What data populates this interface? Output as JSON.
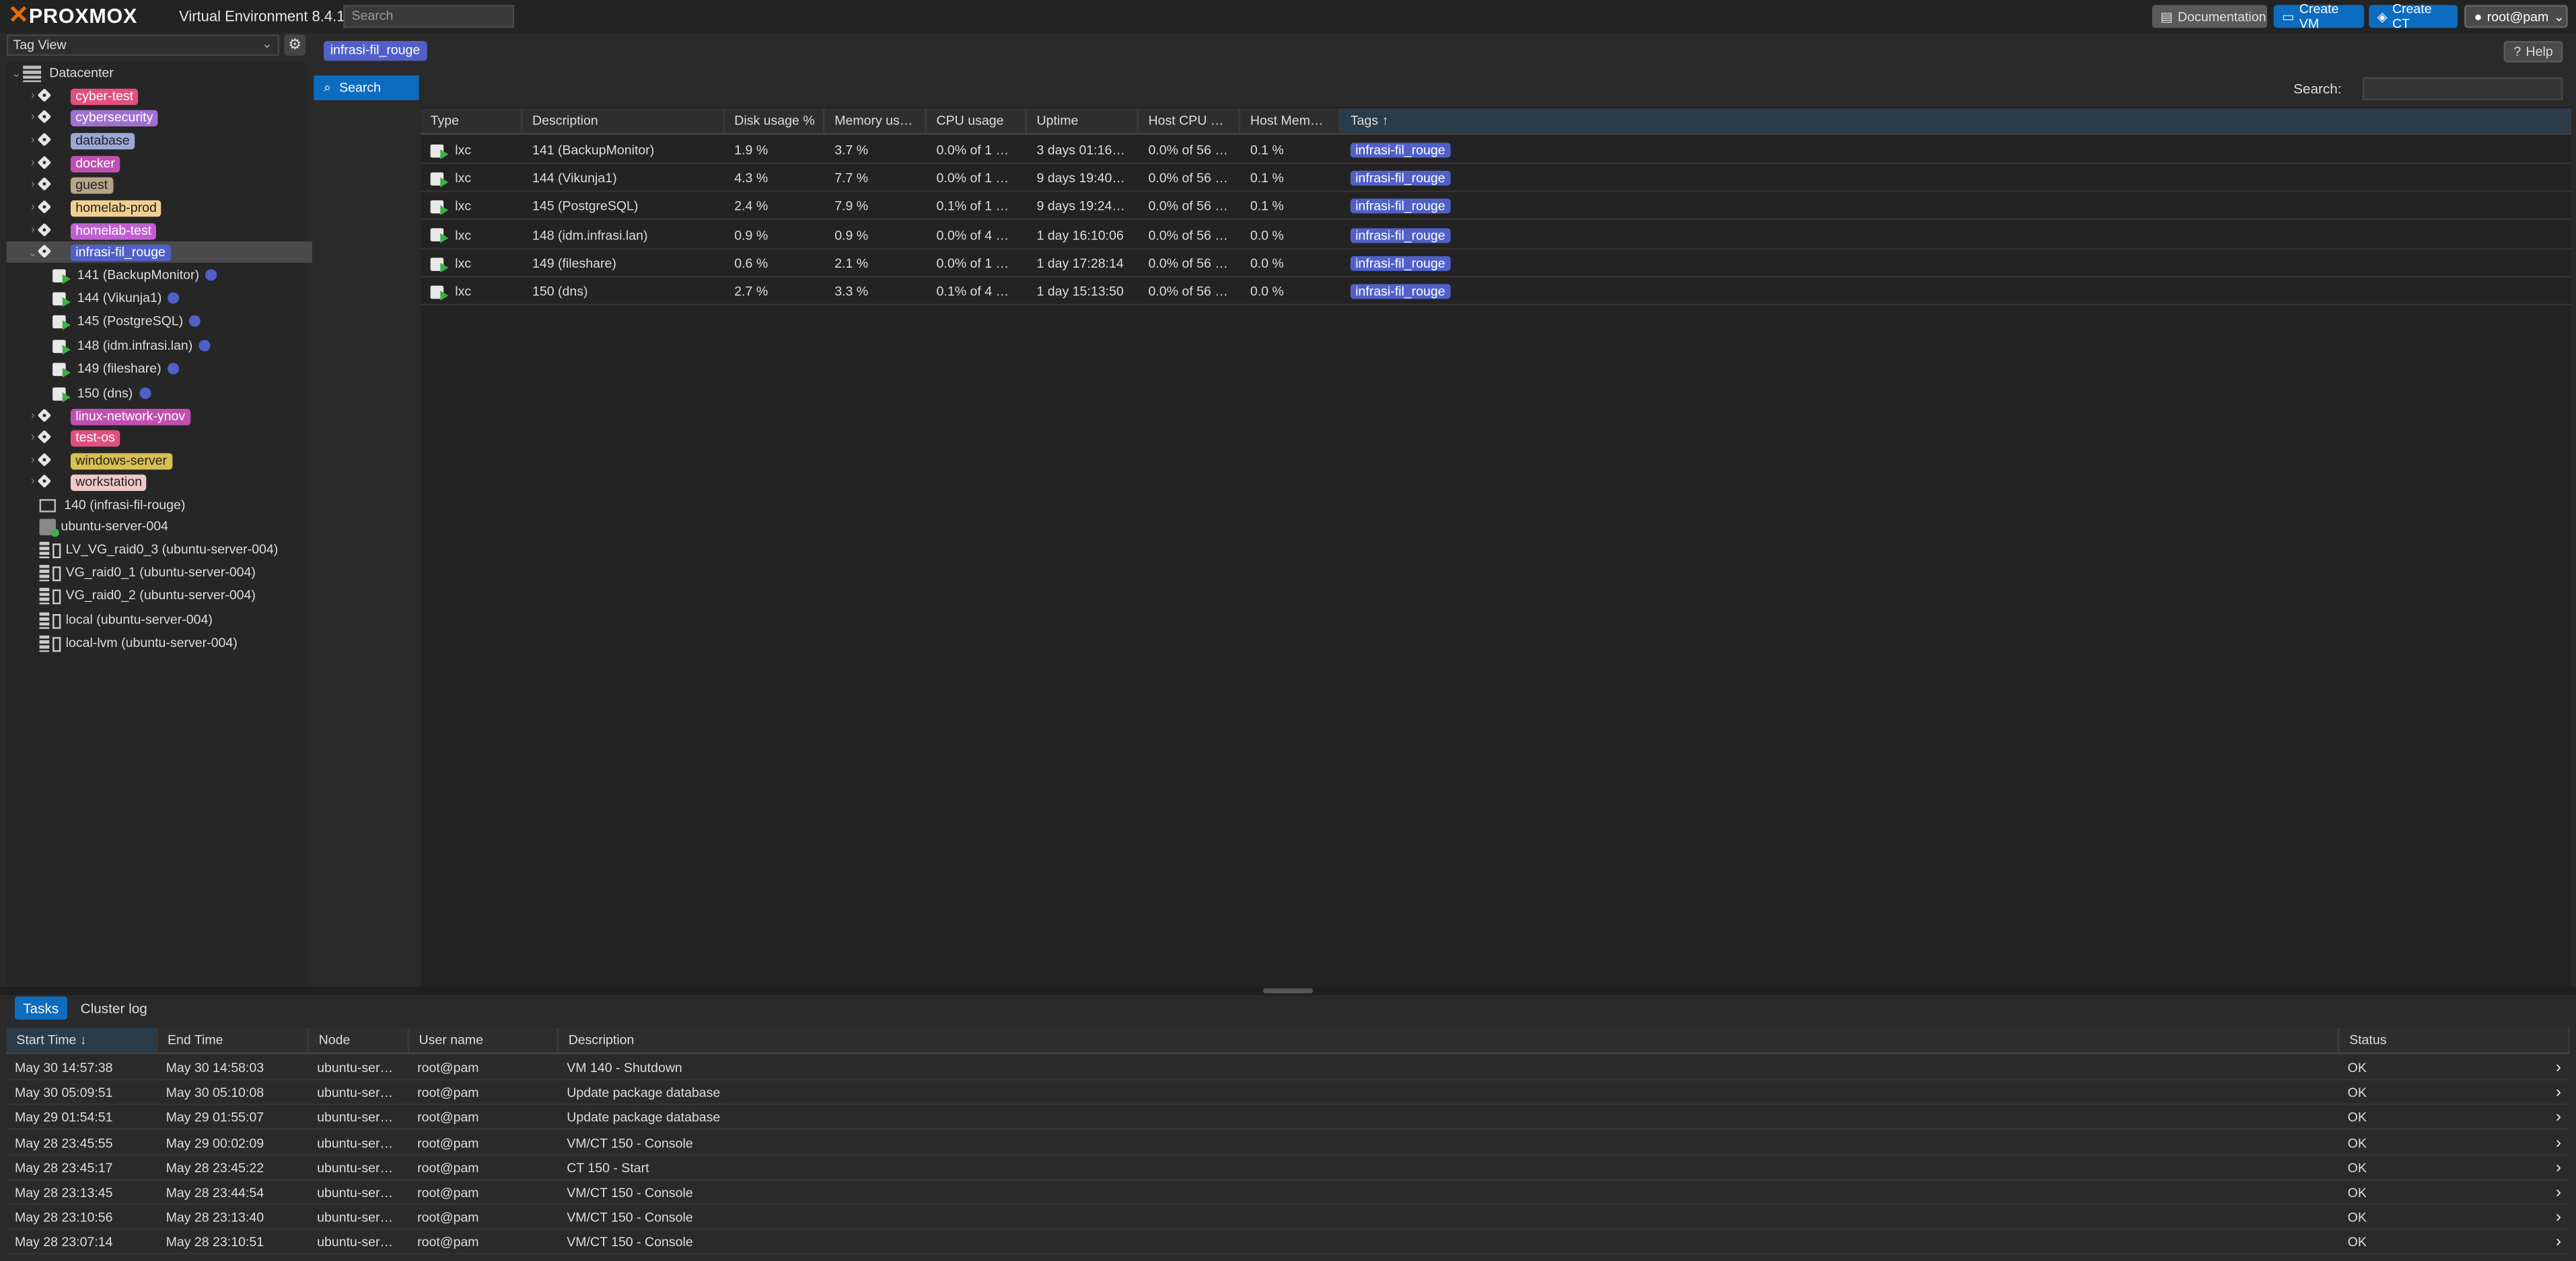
{
  "header": {
    "logo_text": "PROXMOX",
    "version": "Virtual Environment 8.4.1",
    "search_placeholder": "Search",
    "buttons": {
      "documentation": "Documentation",
      "create_vm": "Create VM",
      "create_ct": "Create CT",
      "user": "root@pam"
    }
  },
  "sidebar": {
    "view": "Tag View",
    "tree": [
      {
        "label": "Datacenter",
        "kind": "datacenter",
        "depth": 0,
        "expanded": true
      },
      {
        "label": "cyber-test",
        "kind": "tag",
        "depth": 1,
        "bg": "#e05080",
        "fg": "#ffffff"
      },
      {
        "label": "cybersecurity",
        "kind": "tag",
        "depth": 1,
        "bg": "#a070d0",
        "fg": "#ffffff"
      },
      {
        "label": "database",
        "kind": "tag",
        "depth": 1,
        "bg": "#9aa8d8",
        "fg": "#222222"
      },
      {
        "label": "docker",
        "kind": "tag",
        "depth": 1,
        "bg": "#c050b0",
        "fg": "#ffffff"
      },
      {
        "label": "guest",
        "kind": "tag",
        "depth": 1,
        "bg": "#b8a488",
        "fg": "#222222"
      },
      {
        "label": "homelab-prod",
        "kind": "tag",
        "depth": 1,
        "bg": "#f0d090",
        "fg": "#222222"
      },
      {
        "label": "homelab-test",
        "kind": "tag",
        "depth": 1,
        "bg": "#c060d0",
        "fg": "#ffffff"
      },
      {
        "label": "infrasi-fil_rouge",
        "kind": "tag",
        "depth": 1,
        "bg": "#5060c8",
        "fg": "#ffffff",
        "selected": true,
        "expanded": true
      },
      {
        "label": "141 (BackupMonitor)",
        "kind": "ct",
        "depth": 2
      },
      {
        "label": "144 (Vikunja1)",
        "kind": "ct",
        "depth": 2
      },
      {
        "label": "145 (PostgreSQL)",
        "kind": "ct",
        "depth": 2
      },
      {
        "label": "148 (idm.infrasi.lan)",
        "kind": "ct",
        "depth": 2
      },
      {
        "label": "149 (fileshare)",
        "kind": "ct",
        "depth": 2
      },
      {
        "label": "150 (dns)",
        "kind": "ct",
        "depth": 2
      },
      {
        "label": "linux-network-ynov",
        "kind": "tag",
        "depth": 1,
        "bg": "#c050b0",
        "fg": "#ffffff"
      },
      {
        "label": "test-os",
        "kind": "tag",
        "depth": 1,
        "bg": "#e05080",
        "fg": "#ffffff"
      },
      {
        "label": "windows-server",
        "kind": "tag",
        "depth": 1,
        "bg": "#d8c050",
        "fg": "#222222"
      },
      {
        "label": "workstation",
        "kind": "tag",
        "depth": 1,
        "bg": "#f0c8c8",
        "fg": "#222222"
      },
      {
        "label": "140 (infrasi-fil-rouge)",
        "kind": "vm",
        "depth": 1
      },
      {
        "label": "ubuntu-server-004",
        "kind": "node",
        "depth": 1
      },
      {
        "label": "LV_VG_raid0_3 (ubuntu-server-004)",
        "kind": "storage",
        "depth": 1
      },
      {
        "label": "VG_raid0_1 (ubuntu-server-004)",
        "kind": "storage",
        "depth": 1
      },
      {
        "label": "VG_raid0_2 (ubuntu-server-004)",
        "kind": "storage",
        "depth": 1
      },
      {
        "label": "local (ubuntu-server-004)",
        "kind": "storage",
        "depth": 1
      },
      {
        "label": "local-lvm (ubuntu-server-004)",
        "kind": "storage",
        "depth": 1
      }
    ]
  },
  "content": {
    "breadcrumb": "infrasi-fil_rouge",
    "help": "Help",
    "menu_search": "Search",
    "search_label": "Search:",
    "columns": [
      "Type",
      "Description",
      "Disk usage %",
      "Memory us…",
      "CPU usage",
      "Uptime",
      "Host CPU …",
      "Host Mem…",
      "Tags"
    ],
    "sort_column": "Tags",
    "rows": [
      {
        "type": "lxc",
        "description": "141 (BackupMonitor)",
        "disk": "1.9 %",
        "memory": "3.7 %",
        "cpu": "0.0% of 1 …",
        "uptime": "3 days 01:16…",
        "host_cpu": "0.0% of 56 …",
        "host_mem": "0.1 %",
        "tag": "infrasi-fil_rouge"
      },
      {
        "type": "lxc",
        "description": "144 (Vikunja1)",
        "disk": "4.3 %",
        "memory": "7.7 %",
        "cpu": "0.0% of 1 …",
        "uptime": "9 days 19:40…",
        "host_cpu": "0.0% of 56 …",
        "host_mem": "0.1 %",
        "tag": "infrasi-fil_rouge"
      },
      {
        "type": "lxc",
        "description": "145 (PostgreSQL)",
        "disk": "2.4 %",
        "memory": "7.9 %",
        "cpu": "0.1% of 1 …",
        "uptime": "9 days 19:24…",
        "host_cpu": "0.0% of 56 …",
        "host_mem": "0.1 %",
        "tag": "infrasi-fil_rouge"
      },
      {
        "type": "lxc",
        "description": "148 (idm.infrasi.lan)",
        "disk": "0.9 %",
        "memory": "0.9 %",
        "cpu": "0.0% of 4 …",
        "uptime": "1 day 16:10:06",
        "host_cpu": "0.0% of 56 …",
        "host_mem": "0.0 %",
        "tag": "infrasi-fil_rouge"
      },
      {
        "type": "lxc",
        "description": "149 (fileshare)",
        "disk": "0.6 %",
        "memory": "2.1 %",
        "cpu": "0.0% of 1 …",
        "uptime": "1 day 17:28:14",
        "host_cpu": "0.0% of 56 …",
        "host_mem": "0.0 %",
        "tag": "infrasi-fil_rouge"
      },
      {
        "type": "lxc",
        "description": "150 (dns)",
        "disk": "2.7 %",
        "memory": "3.3 %",
        "cpu": "0.1% of 4 …",
        "uptime": "1 day 15:13:50",
        "host_cpu": "0.0% of 56 …",
        "host_mem": "0.0 %",
        "tag": "infrasi-fil_rouge"
      }
    ]
  },
  "tasks": {
    "tabs": [
      "Tasks",
      "Cluster log"
    ],
    "columns": [
      "Start Time",
      "End Time",
      "Node",
      "User name",
      "Description",
      "Status"
    ],
    "sort_column": "Start Time",
    "rows": [
      {
        "start": "May 30 14:57:38",
        "end": "May 30 14:58:03",
        "node": "ubuntu-ser…",
        "user": "root@pam",
        "desc": "VM 140 - Shutdown",
        "status": "OK"
      },
      {
        "start": "May 30 05:09:51",
        "end": "May 30 05:10:08",
        "node": "ubuntu-ser…",
        "user": "root@pam",
        "desc": "Update package database",
        "status": "OK"
      },
      {
        "start": "May 29 01:54:51",
        "end": "May 29 01:55:07",
        "node": "ubuntu-ser…",
        "user": "root@pam",
        "desc": "Update package database",
        "status": "OK"
      },
      {
        "start": "May 28 23:45:55",
        "end": "May 29 00:02:09",
        "node": "ubuntu-ser…",
        "user": "root@pam",
        "desc": "VM/CT 150 - Console",
        "status": "OK"
      },
      {
        "start": "May 28 23:45:17",
        "end": "May 28 23:45:22",
        "node": "ubuntu-ser…",
        "user": "root@pam",
        "desc": "CT 150 - Start",
        "status": "OK"
      },
      {
        "start": "May 28 23:13:45",
        "end": "May 28 23:44:54",
        "node": "ubuntu-ser…",
        "user": "root@pam",
        "desc": "VM/CT 150 - Console",
        "status": "OK"
      },
      {
        "start": "May 28 23:10:56",
        "end": "May 28 23:13:40",
        "node": "ubuntu-ser…",
        "user": "root@pam",
        "desc": "VM/CT 150 - Console",
        "status": "OK"
      },
      {
        "start": "May 28 23:07:14",
        "end": "May 28 23:10:51",
        "node": "ubuntu-ser…",
        "user": "root@pam",
        "desc": "VM/CT 150 - Console",
        "status": "OK"
      }
    ]
  }
}
